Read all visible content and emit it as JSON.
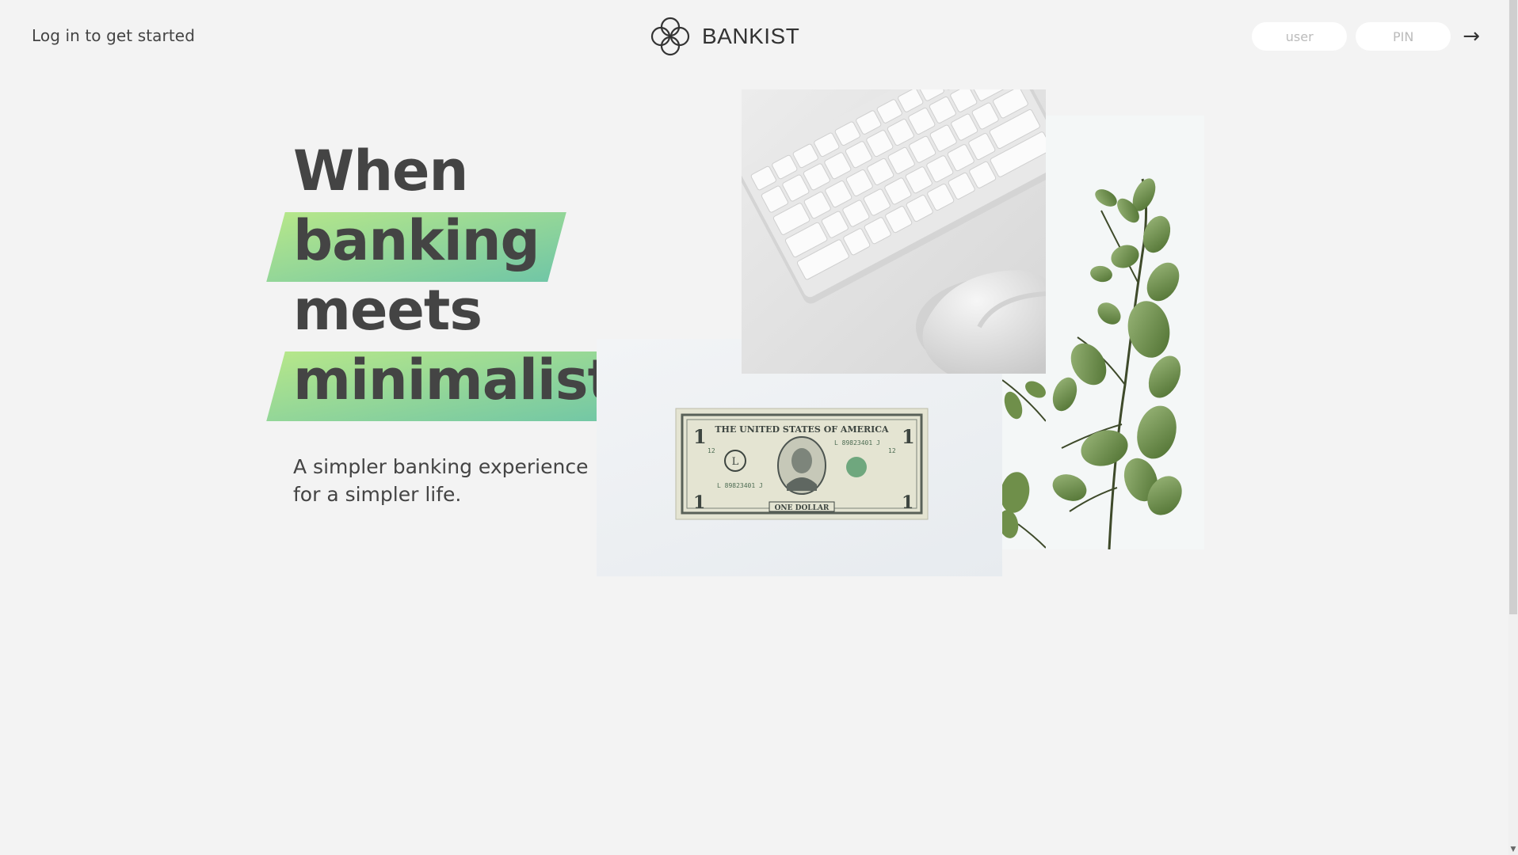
{
  "header": {
    "welcome": "Log in to get started",
    "brand": "BANKIST",
    "login": {
      "user_placeholder": "user",
      "pin_placeholder": "PIN",
      "submit_glyph": "→"
    }
  },
  "hero": {
    "lines": [
      "When",
      "banking",
      "meets",
      "minimalist"
    ],
    "subtitle_line1": "A simpler banking experience",
    "subtitle_line2": "for a simpler life."
  },
  "colors": {
    "background": "#f3f3f3",
    "highlight_start": "#9be15d",
    "highlight_end": "#39b385",
    "text": "#444444"
  },
  "images": {
    "keyboard": "keyboard-mouse-image",
    "plant": "eucalyptus-plant-image",
    "dollar": "one-dollar-bill-image"
  }
}
